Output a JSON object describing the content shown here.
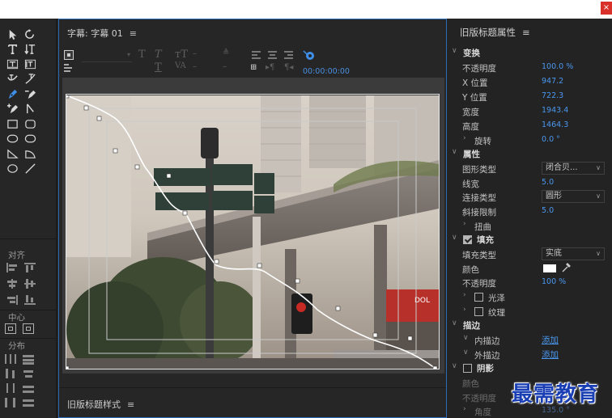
{
  "window": {
    "close_glyph": "×"
  },
  "tools_panel": {
    "section_align": "对齐",
    "section_center": "中心",
    "section_distribute": "分布"
  },
  "title_panel": {
    "title": "字幕: 字幕 01",
    "menu_glyph": "≡",
    "timecode": "00:00:00:00",
    "styles_title": "旧版标题样式"
  },
  "props": {
    "title": "旧版标题属性",
    "menu_glyph": "≡",
    "transform": {
      "label": "变换",
      "opacity_label": "不透明度",
      "opacity": "100.0 %",
      "x_label": "X 位置",
      "x": "947.2",
      "y_label": "Y 位置",
      "y": "722.3",
      "width_label": "宽度",
      "width": "1943.4",
      "height_label": "高度",
      "height": "1464.3",
      "rotation_label": "旋转",
      "rotation": "0.0 °"
    },
    "attributes": {
      "label": "属性",
      "shape_label": "图形类型",
      "shape": "闭合贝...",
      "line_width_label": "线宽",
      "line_width": "5.0",
      "join_label": "连接类型",
      "join": "圆形",
      "miter_label": "斜接限制",
      "miter": "5.0",
      "distort_label": "扭曲"
    },
    "fill": {
      "label": "填充",
      "type_label": "填充类型",
      "type": "实底",
      "color_label": "颜色",
      "color": "#ffffff",
      "opacity_label": "不透明度",
      "opacity": "100 %",
      "sheen_label": "光泽",
      "texture_label": "纹理"
    },
    "stroke": {
      "label": "描边",
      "inner_label": "内描边",
      "inner_add": "添加",
      "outer_label": "外描边",
      "outer_add": "添加"
    },
    "shadow": {
      "label": "阴影",
      "color_label": "颜色",
      "opacity_label": "不透明度",
      "angle_label": "角度",
      "angle": "135.0 °"
    }
  },
  "watermark": "最需教育",
  "colors": {
    "accent": "#4a97ef",
    "panel_border": "#2d6bb8",
    "watermark": "#1a3fb5"
  }
}
